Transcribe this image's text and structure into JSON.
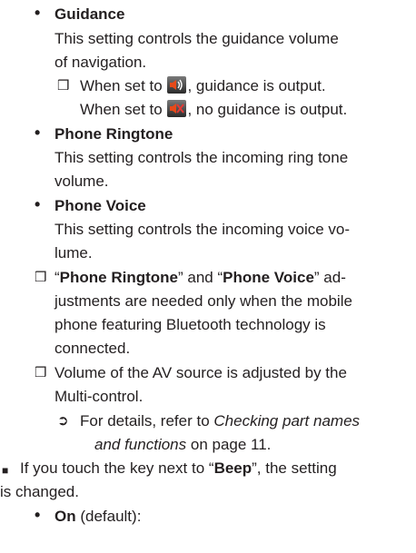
{
  "guidance": {
    "title": "Guidance",
    "desc_1": "This setting controls the guidance volume",
    "desc_2": "of navigation.",
    "note_1_a": "When set to",
    "note_1_b": ", guidance is output.",
    "note_2_a": "When set to",
    "note_2_b": ", no guidance is output.",
    "icon_on": "speaker-on-icon",
    "icon_off": "speaker-muted-icon"
  },
  "phone_ringtone": {
    "title": "Phone Ringtone",
    "desc_1": "This setting controls the incoming ring tone",
    "desc_2": "volume."
  },
  "phone_voice": {
    "title": "Phone Voice",
    "desc_1": "This setting controls the incoming voice vo-",
    "desc_2": "lume."
  },
  "note_bt": {
    "q1": "“",
    "ringtone": "Phone Ringtone",
    "mid": "” and “",
    "voice": "Phone Voice",
    "end_1": "” ad-",
    "line_2": "justments are needed only when the mobile",
    "line_3": "phone featuring Bluetooth technology is",
    "line_4": "connected."
  },
  "note_av": {
    "line_1": "Volume of the AV source is adjusted by the",
    "line_2": "Multi-control.",
    "ref_1a": "For details, refer to ",
    "ref_1b": "Checking part names",
    "ref_2a": "and functions",
    "ref_2b": " on page 11."
  },
  "beep": {
    "line_1a": "If you touch the key next to “",
    "key": "Beep",
    "line_1b": "”, the setting",
    "line_2": "is changed."
  },
  "on_item": {
    "label": "On",
    "rest": " (default):"
  }
}
